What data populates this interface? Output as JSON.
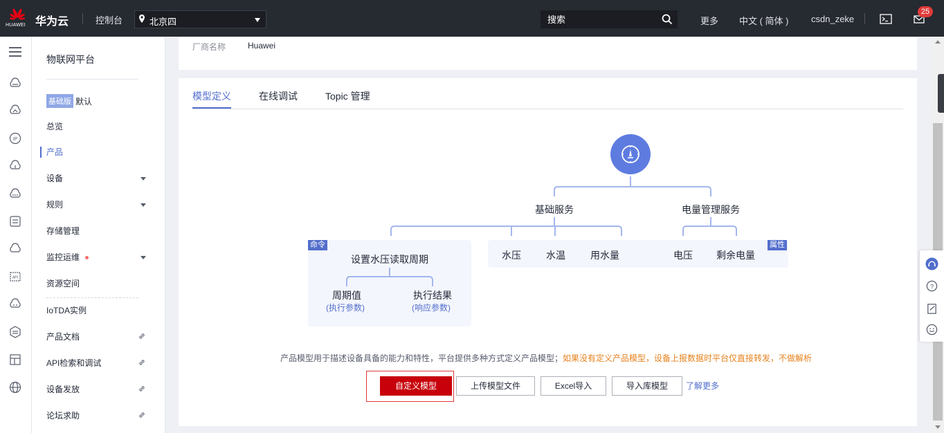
{
  "topbar": {
    "logo_text": "HUAWEI",
    "brand": "华为云",
    "console": "控制台",
    "region": "北京四",
    "search_placeholder": "搜索",
    "more": "更多",
    "language": "中文 ( 简体 )",
    "username": "csdn_zeke",
    "mail_count": "25"
  },
  "subnav": {
    "title": "物联网平台",
    "edition_badge": "基础版",
    "edition_name": "默认",
    "items": {
      "overview": "总览",
      "product": "产品",
      "device": "设备",
      "rules": "规则",
      "storage": "存储管理",
      "monitor": "监控运维",
      "resource": "资源空间",
      "iotda": "IoTDA实例",
      "docs": "产品文档",
      "api": "API检索和调试",
      "provision": "设备发放",
      "forum": "论坛求助"
    }
  },
  "product_info": {
    "vendor_label": "厂商名称",
    "vendor_value": "Huawei"
  },
  "tabs": {
    "model": "模型定义",
    "debug": "在线调试",
    "topic": "Topic 管理"
  },
  "diagram": {
    "service_basic": "基础服务",
    "service_power": "电量管理服务",
    "tag_command": "命令",
    "tag_property": "属性",
    "command_name": "设置水压读取周期",
    "param_period": "周期值",
    "param_period_sub": "(执行参数)",
    "param_result": "执行结果",
    "param_result_sub": "(响应参数)",
    "prop_pressure": "水压",
    "prop_temp": "水温",
    "prop_usage": "用水量",
    "prop_voltage": "电压",
    "prop_battery": "剩余电量"
  },
  "hint": {
    "normal": "产品模型用于描述设备具备的能力和特性，平台提供多种方式定义产品模型；",
    "warn": "如果没有定义产品模型，设备上报数据时平台仅直接转发，不做解析"
  },
  "actions": {
    "custom_model": "自定义模型",
    "upload_model": "上传模型文件",
    "excel_import": "Excel导入",
    "library_import": "导入库模型",
    "learn_more": "了解更多"
  },
  "colors": {
    "topbar_bg": "#262a31",
    "accent": "#526ecc",
    "primary_red": "#c7000b",
    "warn": "#e6821e"
  }
}
